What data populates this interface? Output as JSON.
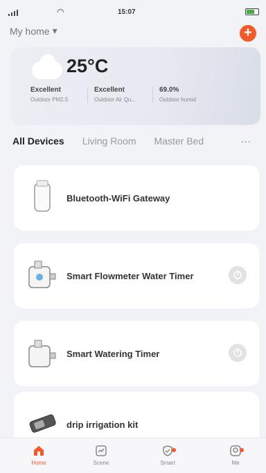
{
  "status_bar": {
    "carrier": "",
    "time": "15:07",
    "right": ""
  },
  "header": {
    "home_label": "My home",
    "chevron": "▾",
    "add_icon": "plus-icon"
  },
  "weather": {
    "icon": "cloud-icon",
    "temperature": "25°C",
    "metrics": [
      {
        "value": "Excellent",
        "label": "Outdoor PM2.5"
      },
      {
        "value": "Excellent",
        "label": "Outdoor Air Qu..."
      },
      {
        "value": "69.0%",
        "label": "Outdoor humid"
      }
    ]
  },
  "room_tabs": {
    "items": [
      "All Devices",
      "Living Room",
      "Master Bed"
    ],
    "more": "···"
  },
  "devices": [
    {
      "name": "Bluetooth-WiFi Gateway",
      "icon": "gateway-icon",
      "has_power": false
    },
    {
      "name": "Smart Flowmeter Water Timer",
      "icon": "water-timer-icon",
      "has_power": true
    },
    {
      "name": "Smart Watering Timer",
      "icon": "watering-timer-icon",
      "has_power": true
    },
    {
      "name": "drip irrigation kit",
      "icon": "drip-kit-icon",
      "has_power": false
    }
  ],
  "tab_bar": {
    "items": [
      {
        "label": "Home",
        "icon": "home-icon"
      },
      {
        "label": "Scene",
        "icon": "scene-icon"
      },
      {
        "label": "Smart",
        "icon": "smart-icon"
      },
      {
        "label": "Me",
        "icon": "me-icon"
      }
    ]
  },
  "colors": {
    "accent": "#f25a2a",
    "background": "#f2f3f7"
  }
}
